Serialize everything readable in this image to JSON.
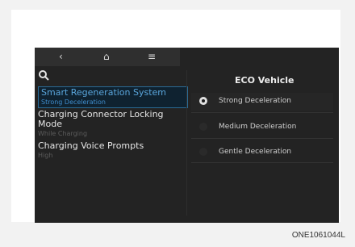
{
  "topbar": {
    "back_icon": "‹",
    "home_icon": "⌂",
    "menu_icon": "≡"
  },
  "left_list": [
    {
      "title": "Smart Regeneration System",
      "sub": "Strong Deceleration"
    },
    {
      "title": "Charging Connector Locking Mode",
      "sub": "While Charging"
    },
    {
      "title": "Charging Voice Prompts",
      "sub": "High"
    }
  ],
  "panel": {
    "title": "ECO Vehicle",
    "options": [
      {
        "label": "Strong Deceleration",
        "selected": true
      },
      {
        "label": "Medium Deceleration",
        "selected": false
      },
      {
        "label": "Gentle Deceleration",
        "selected": false
      }
    ]
  },
  "caption": "ONE1061044L"
}
